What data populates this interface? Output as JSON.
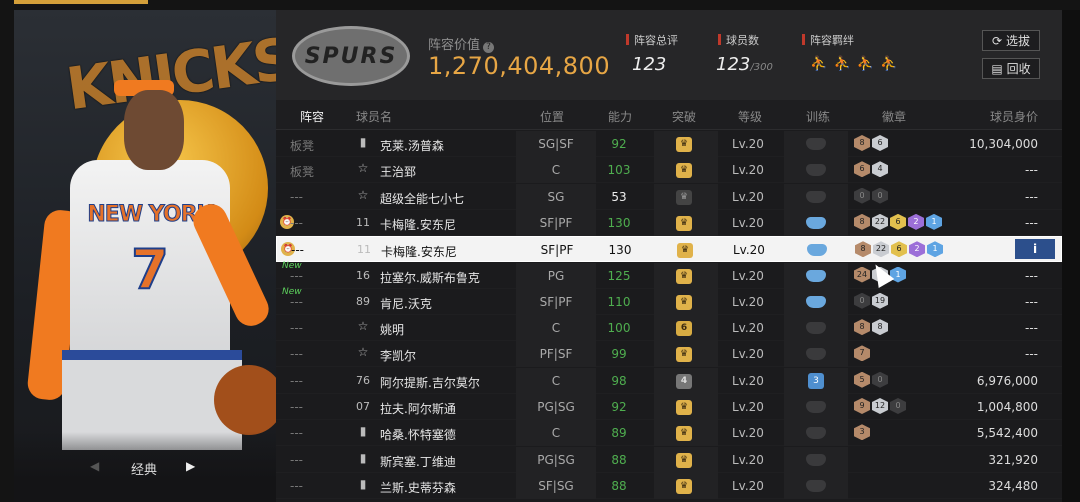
{
  "portrait": {
    "team_text": "KNICKS",
    "jersey_team": "NEW YORK",
    "jersey_number": "7",
    "nav_label": "经典",
    "nav_prev_icon": "chevron-left-icon",
    "nav_next_icon": "play-right-icon"
  },
  "header": {
    "logo_text": "SPURS",
    "value_label": "阵容价值",
    "value_help_icon": "question-icon",
    "value": "1,270,404,800",
    "rating_label": "阵容总评",
    "rating_value": "123",
    "count_label": "球员数",
    "count_value": "123",
    "count_max": "/300",
    "chem_label": "阵容羁绊",
    "btn_select": "选拔",
    "btn_recycle": "回收"
  },
  "columns": [
    "阵容",
    "球员名",
    "位置",
    "能力",
    "突破",
    "等级",
    "训练",
    "徽章",
    "球员身价"
  ],
  "rows": [
    {
      "lineup": "板凳",
      "icon": "bars",
      "name": "克莱.汤普森",
      "pos": "SG|SF",
      "ability": "92",
      "ability_white": false,
      "up": "crown",
      "level": "Lv.20",
      "train": "dark",
      "medals": [
        [
          "b",
          "8"
        ],
        [
          "s",
          "6"
        ]
      ],
      "worth": "10,304,000"
    },
    {
      "lineup": "板凳",
      "icon": "star",
      "name": "王治郅",
      "pos": "C",
      "ability": "103",
      "ability_white": false,
      "up": "crown",
      "level": "Lv.20",
      "train": "dark",
      "medals": [
        [
          "b",
          "6"
        ],
        [
          "s",
          "4"
        ]
      ],
      "worth": "---"
    },
    {
      "lineup": "---",
      "icon": "star",
      "name": "超级全能七小七",
      "pos": "SG",
      "ability": "53",
      "ability_white": true,
      "up": "gray",
      "level": "Lv.20",
      "train": "dark",
      "medals": [
        [
          "d",
          "0"
        ],
        [
          "d",
          "0"
        ]
      ],
      "worth": "---"
    },
    {
      "lineup": "---",
      "icon": "11",
      "name": "卡梅隆.安东尼",
      "pos": "SF|PF",
      "ability": "130",
      "ability_white": false,
      "up": "crown",
      "level": "Lv.20",
      "train": "blue",
      "medals": [
        [
          "b",
          "8"
        ],
        [
          "s",
          "22"
        ],
        [
          "g",
          "6"
        ],
        [
          "p",
          "2"
        ],
        [
          "bl",
          "1"
        ]
      ],
      "worth": "---",
      "side": "alarm"
    },
    {
      "lineup": "---",
      "icon": "11",
      "name": "卡梅隆.安东尼",
      "pos": "SF|PF",
      "ability": "130",
      "ability_white": false,
      "up": "crown",
      "level": "Lv.20",
      "train": "blue",
      "medals": [
        [
          "b",
          "8"
        ],
        [
          "s",
          "22"
        ],
        [
          "g",
          "6"
        ],
        [
          "p",
          "2"
        ],
        [
          "bl",
          "1"
        ]
      ],
      "worth": "i",
      "selected": true,
      "side": "alarm"
    },
    {
      "lineup": "---",
      "icon": "16",
      "name": "拉塞尔.威斯布鲁克",
      "pos": "PG",
      "ability": "125",
      "ability_white": false,
      "up": "crown",
      "level": "Lv.20",
      "train": "blue",
      "medals": [
        [
          "b",
          "24"
        ],
        [
          "s",
          "0"
        ],
        [
          "bl",
          "1"
        ]
      ],
      "worth": "---",
      "side": "new"
    },
    {
      "lineup": "---",
      "icon": "89",
      "name": "肯尼.沃克",
      "pos": "SF|PF",
      "ability": "110",
      "ability_white": false,
      "up": "crown",
      "level": "Lv.20",
      "train": "blue",
      "medals": [
        [
          "d",
          "0"
        ],
        [
          "s",
          "19"
        ]
      ],
      "worth": "---",
      "side": "new"
    },
    {
      "lineup": "---",
      "icon": "star",
      "name": "姚明",
      "pos": "C",
      "ability": "100",
      "ability_white": false,
      "up": "6",
      "level": "Lv.20",
      "train": "dark",
      "medals": [
        [
          "b",
          "8"
        ],
        [
          "s",
          "8"
        ]
      ],
      "worth": "---"
    },
    {
      "lineup": "---",
      "icon": "star",
      "name": "李凯尔",
      "pos": "PF|SF",
      "ability": "99",
      "ability_white": false,
      "up": "crown",
      "level": "Lv.20",
      "train": "dark",
      "medals": [
        [
          "b",
          "7"
        ]
      ],
      "worth": "---"
    },
    {
      "lineup": "---",
      "icon": "76",
      "name": "阿尔提斯.吉尔莫尔",
      "pos": "C",
      "ability": "98",
      "ability_white": false,
      "up": "4",
      "level": "Lv.20",
      "train": "3",
      "medals": [
        [
          "b",
          "5"
        ],
        [
          "d",
          "0"
        ]
      ],
      "worth": "6,976,000"
    },
    {
      "lineup": "---",
      "icon": "07",
      "name": "拉夫.阿尔斯通",
      "pos": "PG|SG",
      "ability": "92",
      "ability_white": false,
      "up": "crown",
      "level": "Lv.20",
      "train": "dark",
      "medals": [
        [
          "b",
          "9"
        ],
        [
          "s",
          "12"
        ],
        [
          "d",
          "0"
        ]
      ],
      "worth": "1,004,800"
    },
    {
      "lineup": "---",
      "icon": "bars",
      "name": "哈桑.怀特塞德",
      "pos": "C",
      "ability": "89",
      "ability_white": false,
      "up": "crown",
      "level": "Lv.20",
      "train": "dark",
      "medals": [
        [
          "b",
          "3"
        ]
      ],
      "worth": "5,542,400"
    },
    {
      "lineup": "---",
      "icon": "bars",
      "name": "斯宾塞.丁维迪",
      "pos": "PG|SG",
      "ability": "88",
      "ability_white": false,
      "up": "crown",
      "level": "Lv.20",
      "train": "dark",
      "medals": [],
      "worth": "321,920"
    },
    {
      "lineup": "---",
      "icon": "bars",
      "name": "兰斯.史蒂芬森",
      "pos": "SF|SG",
      "ability": "88",
      "ability_white": false,
      "up": "crown",
      "level": "Lv.20",
      "train": "dark",
      "medals": [],
      "worth": "324,480"
    }
  ],
  "side_labels": {
    "new": "New"
  }
}
